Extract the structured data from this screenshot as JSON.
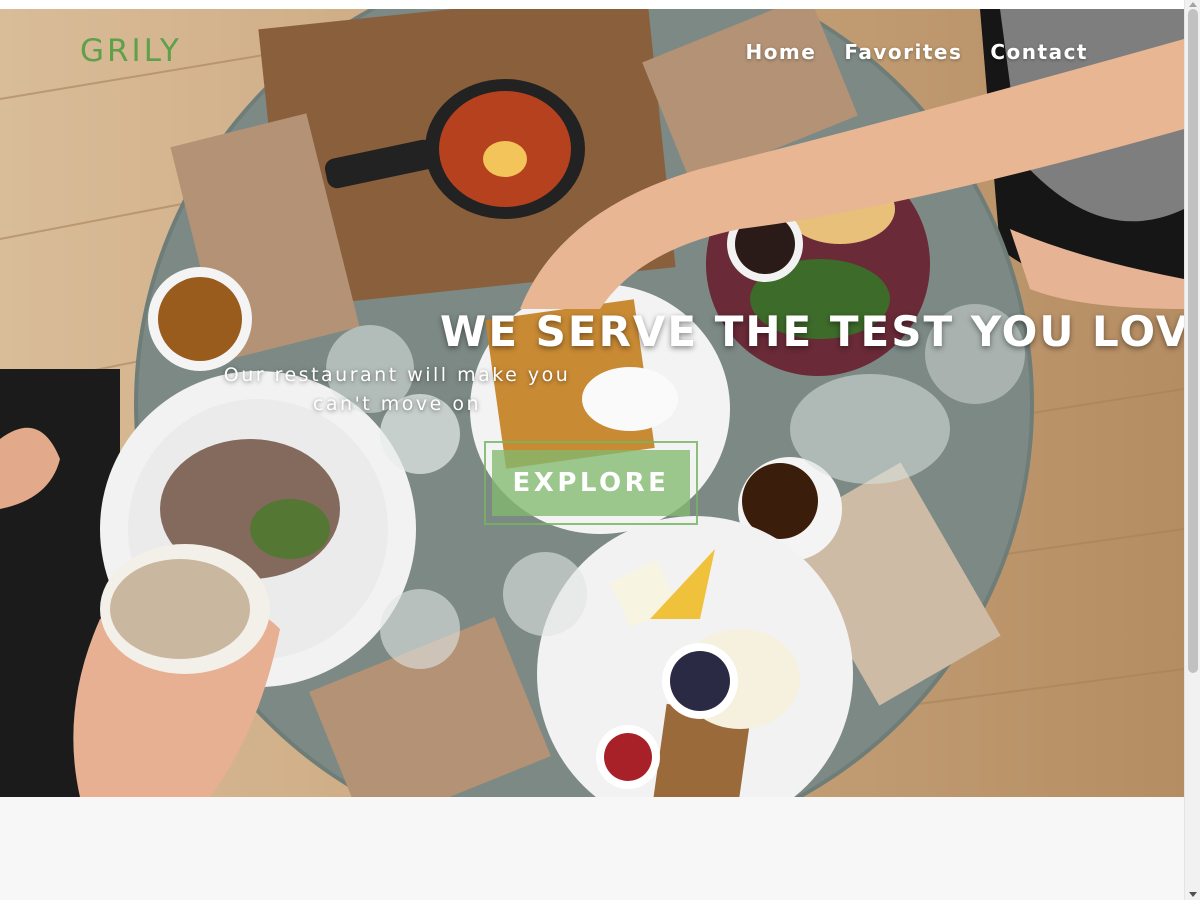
{
  "brand": {
    "logo": "GRILY",
    "color": "#5fa04a"
  },
  "nav": {
    "items": [
      "Home",
      "Favorites",
      "Contact"
    ]
  },
  "hero": {
    "headline": "WE SERVE THE TEST YOU LOVE",
    "subline": "Our restaurant will make you can't move on",
    "cta": "EXPLORE",
    "accent": "#82b96e"
  }
}
